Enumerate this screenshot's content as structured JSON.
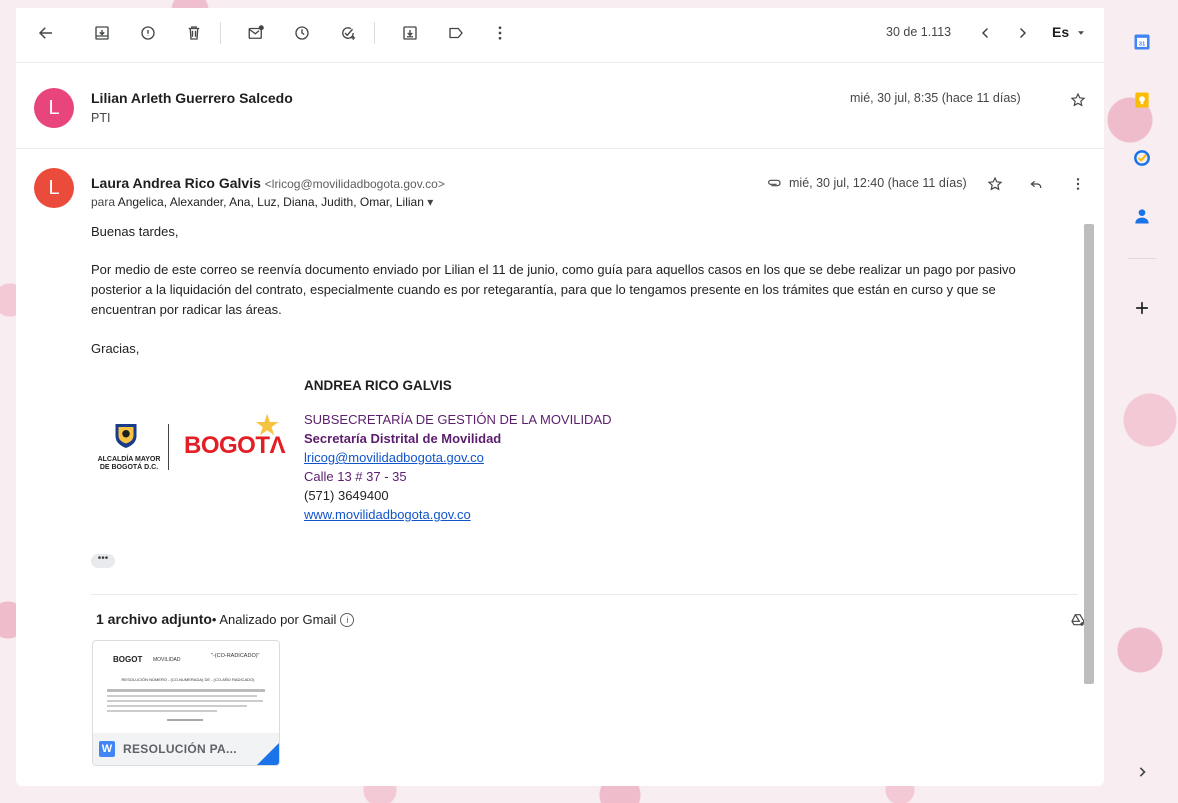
{
  "toolbar": {
    "count": "30 de 1.113",
    "lang": "Es"
  },
  "message1": {
    "avatar_letter": "L",
    "avatar_color": "#e8457c",
    "sender": "Lilian Arleth Guerrero Salcedo",
    "snippet": "PTI",
    "date": "mié, 30 jul, 8:35 (hace 11 días)"
  },
  "message2": {
    "avatar_letter": "L",
    "avatar_color": "#ea4b3a",
    "sender": "Laura Andrea Rico Galvis",
    "email": "<lricog@movilidadbogota.gov.co>",
    "to_prefix": "para",
    "to_list": "Angelica, Alexander, Ana, Luz, Diana, Judith, Omar, Lilian",
    "date": "mié, 30 jul, 12:40 (hace 11 días)",
    "greeting": "Buenas tardes,",
    "paragraph_1": "Por medio de este correo se reenvía documento enviado por Lilian el 11 de junio, como guía para aquellos casos en los que se debe realizar un pago por pasivo",
    "paragraph_2": "posterior a la liquidación del contrato, especialmente cuando es por retegarantía, para que lo tengamos presente en los trámites que están en curso y que se",
    "paragraph_3": "encuentran por radicar las áreas.",
    "thanks": "Gracias,"
  },
  "signature": {
    "name": "ANDREA RICO GALVIS",
    "dept": "SUBSECRETARÍA DE GESTIÓN DE LA MOVILIDAD",
    "org": "Secretaría Distrital de Movilidad",
    "email": "lricog@movilidadbogota.gov.co",
    "address": "Calle 13 # 37 - 35",
    "phone": "(571) 3649400",
    "web": "www.movilidadbogota.gov.co",
    "logo_text_1": "ALCALDÍA MAYOR",
    "logo_text_2": "DE BOGOTÁ D.C.",
    "bogota": "BOGOT"
  },
  "attachments": {
    "title": "1 archivo adjunto",
    "subtitle": "• Analizado por Gmail",
    "file_name": "RESOLUCIÓN PA...",
    "thumb_brand": "BOGOT",
    "thumb_mov": "MOVILIDAD",
    "thumb_radicado": "\"-(CO-RADICADO)\"",
    "thumb_heading": "RESOLUCIÓN NÚMERO - (CO-NUMERADA) DE - (CO-AÑO RADICADO)"
  }
}
